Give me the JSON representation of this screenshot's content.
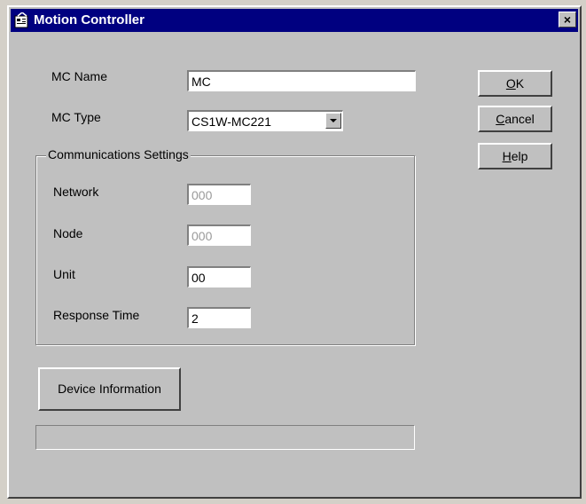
{
  "window": {
    "title": "Motion Controller",
    "close_label": "×"
  },
  "form": {
    "mc_name_label": "MC Name",
    "mc_name_value": "MC",
    "mc_type_label": "MC Type",
    "mc_type_value": "CS1W-MC221"
  },
  "communications": {
    "legend": "Communications Settings",
    "network_label": "Network",
    "network_value": "000",
    "node_label": "Node",
    "node_value": "000",
    "unit_label": "Unit",
    "unit_value": "00",
    "response_time_label": "Response Time",
    "response_time_value": "2"
  },
  "buttons": {
    "ok_accel": "O",
    "ok_rest": "K",
    "cancel_accel": "C",
    "cancel_rest": "ancel",
    "help_accel": "H",
    "help_rest": "elp",
    "device_information": "Device Information"
  },
  "status": {
    "progress_text": ""
  },
  "icons": {
    "title_icon": "properties-icon",
    "combo_arrow": "chevron-down-icon"
  }
}
